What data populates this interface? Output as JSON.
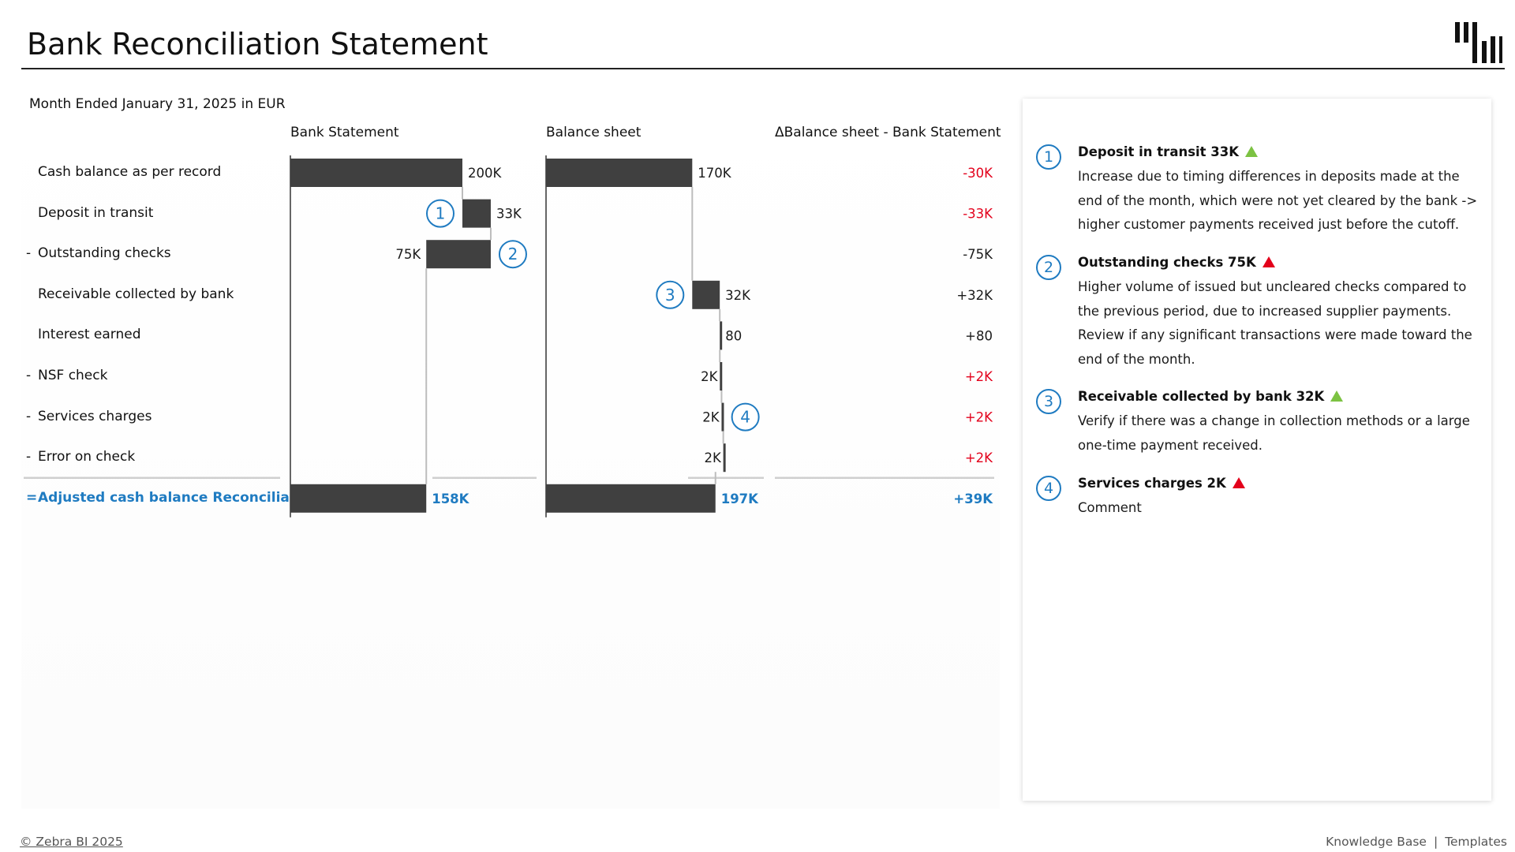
{
  "header": {
    "title": "Bank Reconciliation Statement"
  },
  "subtitle": "Month Ended January 31, 2025 in EUR",
  "columns": {
    "bank": "Bank Statement",
    "balance": "Balance sheet",
    "delta": "ΔBalance sheet - Bank Statement"
  },
  "chart_data": {
    "type": "bar",
    "subtype": "waterfall",
    "categories": [
      "Cash balance as per record",
      "Deposit in transit",
      "Outstanding checks",
      "Receivable collected by bank",
      "Interest earned",
      "NSF check",
      "Services charges",
      "Error on check",
      "Adjusted cash balance Reconciliation"
    ],
    "prefixes": [
      "",
      "",
      "-",
      "",
      "",
      "-",
      "-",
      "-",
      "="
    ],
    "series": [
      {
        "name": "Bank Statement",
        "kinds": [
          "total",
          "delta",
          "delta",
          "none",
          "none",
          "none",
          "none",
          "none",
          "total"
        ],
        "values": [
          200000,
          33000,
          -75000,
          0,
          0,
          0,
          0,
          0,
          158000
        ],
        "labels": [
          "200K",
          "33K",
          "75K",
          "",
          "",
          "",
          "",
          "",
          "158K"
        ]
      },
      {
        "name": "Balance sheet",
        "kinds": [
          "total",
          "none",
          "none",
          "delta",
          "delta",
          "delta",
          "delta",
          "delta",
          "total"
        ],
        "values": [
          170000,
          0,
          0,
          32000,
          80,
          2000,
          2000,
          2000,
          197000
        ],
        "labels": [
          "170K",
          "",
          "",
          "32K",
          "80",
          "2K",
          "2K",
          "2K",
          "197K"
        ]
      }
    ],
    "delta_labels": [
      "-30K",
      "-33K",
      "-75K",
      "+32K",
      "+80",
      "+2K",
      "+2K",
      "+2K",
      "+39K"
    ],
    "delta_colors": [
      "#e3001b",
      "#e3001b",
      "#1a1a1a",
      "#1a1a1a",
      "#1a1a1a",
      "#e3001b",
      "#e3001b",
      "#e3001b",
      "#1f7bc1"
    ],
    "markers": [
      {
        "series": 0,
        "row": 1,
        "side": "left",
        "label": "1"
      },
      {
        "series": 0,
        "row": 2,
        "side": "right",
        "label": "2"
      },
      {
        "series": 1,
        "row": 3,
        "side": "left",
        "label": "3"
      },
      {
        "series": 1,
        "row": 6,
        "side": "right",
        "label": "4"
      }
    ],
    "colors": {
      "bar": "#404040",
      "total_text": "#1f7bc1",
      "marker": "#1f7bc1",
      "negative": "#e3001b"
    }
  },
  "notes": [
    {
      "num": "1",
      "title": "Deposit in transit 33K",
      "trend": "up-green",
      "body": "Increase due to timing differences in deposits made at the end of the month, which were not yet cleared by the bank -> higher customer payments received just before the cutoff."
    },
    {
      "num": "2",
      "title": "Outstanding checks 75K",
      "trend": "up-red",
      "body": "Higher volume of issued but uncleared checks compared to the previous period, due to increased supplier payments. Review if any significant transactions were made toward the end of the month."
    },
    {
      "num": "3",
      "title": "Receivable collected by bank 32K",
      "trend": "up-green",
      "body": "Verify if there was a change in collection methods or a large one-time payment received."
    },
    {
      "num": "4",
      "title": "Services charges 2K",
      "trend": "up-red",
      "body": "Comment"
    }
  ],
  "footer": {
    "copyright": "© Zebra BI 2025",
    "link1": "Knowledge Base",
    "separator": "|",
    "link2": "Templates"
  }
}
